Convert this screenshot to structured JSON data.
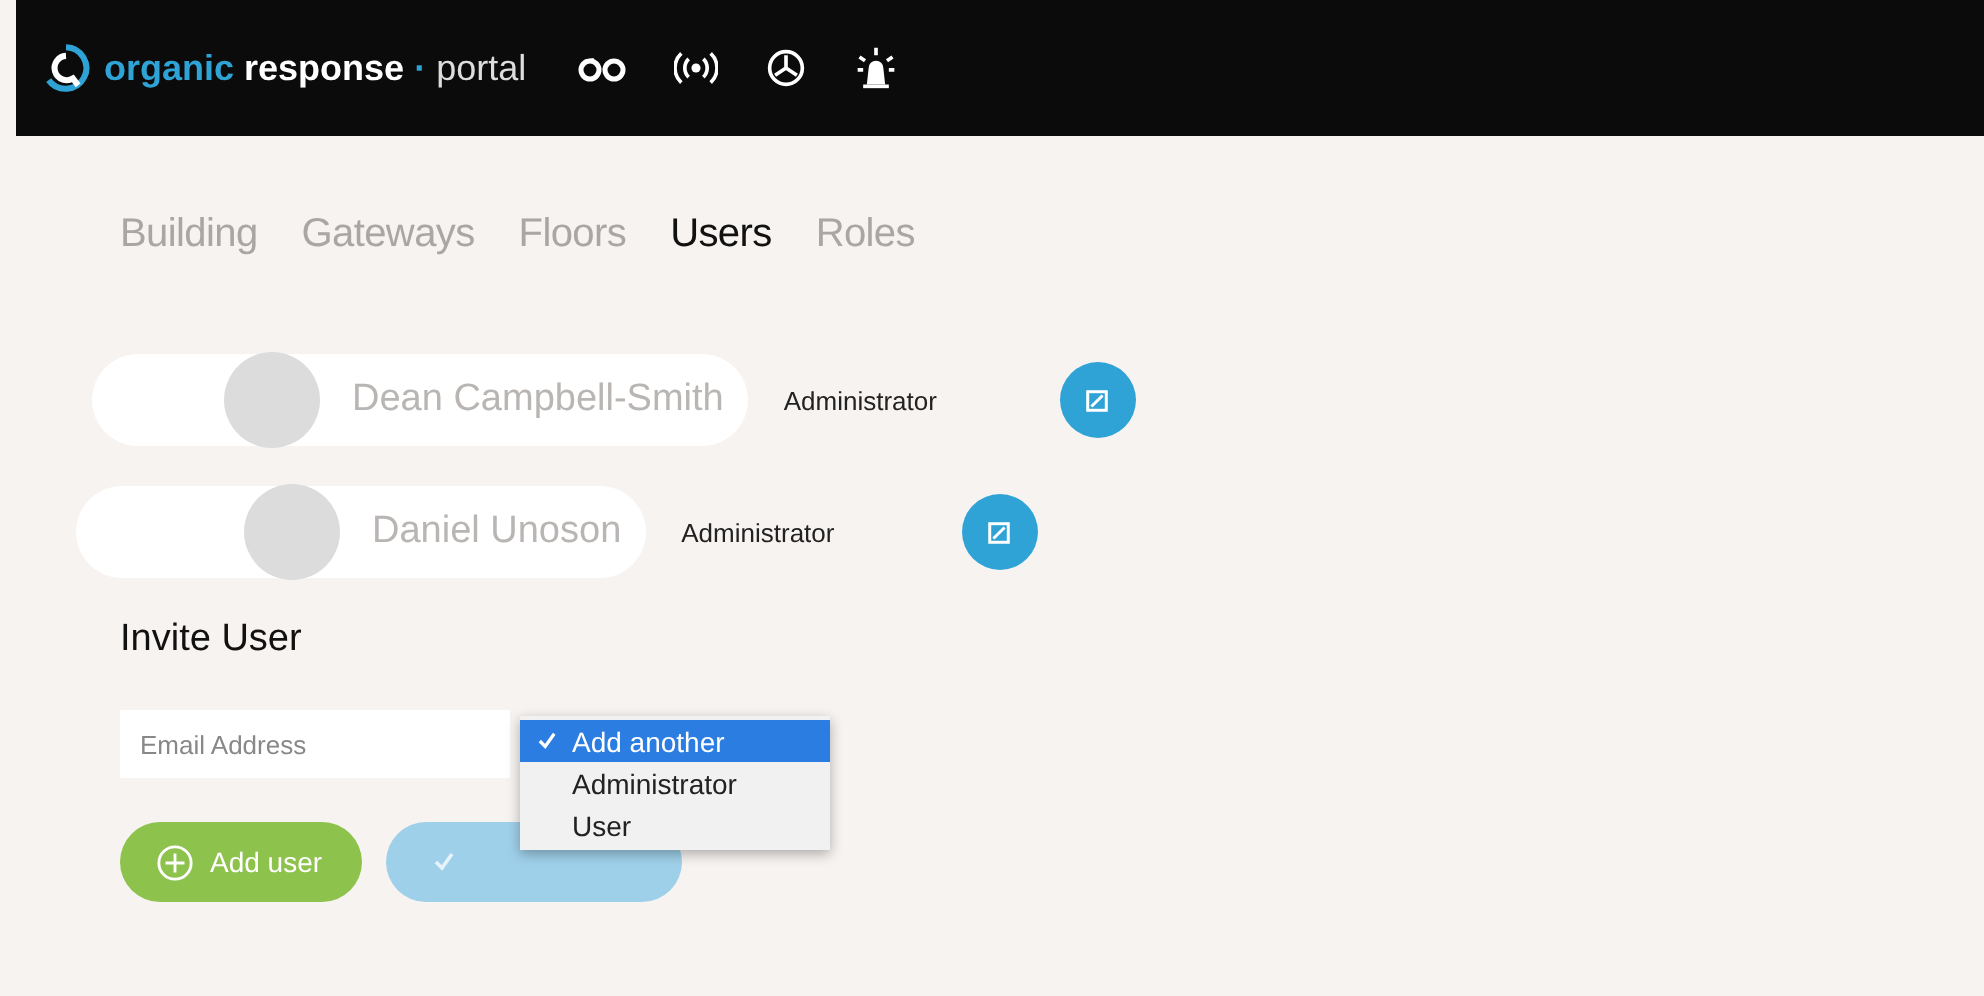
{
  "header": {
    "brand": {
      "part_1": "organic",
      "part_2": "response",
      "separator": "·",
      "part_3": "portal"
    }
  },
  "tabs": [
    {
      "label": "Building",
      "selected": false
    },
    {
      "label": "Gateways",
      "selected": false
    },
    {
      "label": "Floors",
      "selected": false
    },
    {
      "label": "Users",
      "selected": true
    },
    {
      "label": "Roles",
      "selected": false
    }
  ],
  "users": [
    {
      "name": "Dean Campbell-Smith",
      "role": "Administrator"
    },
    {
      "name": "Daniel Unoson",
      "role": "Administrator"
    }
  ],
  "invite": {
    "title": "Invite User",
    "email": {
      "placeholder": "Email Address"
    },
    "role_menu": [
      {
        "label": "Add another",
        "selected": true
      },
      {
        "label": "Administrator",
        "selected": false
      },
      {
        "label": "User",
        "selected": false
      }
    ],
    "add_button": "Add user"
  }
}
